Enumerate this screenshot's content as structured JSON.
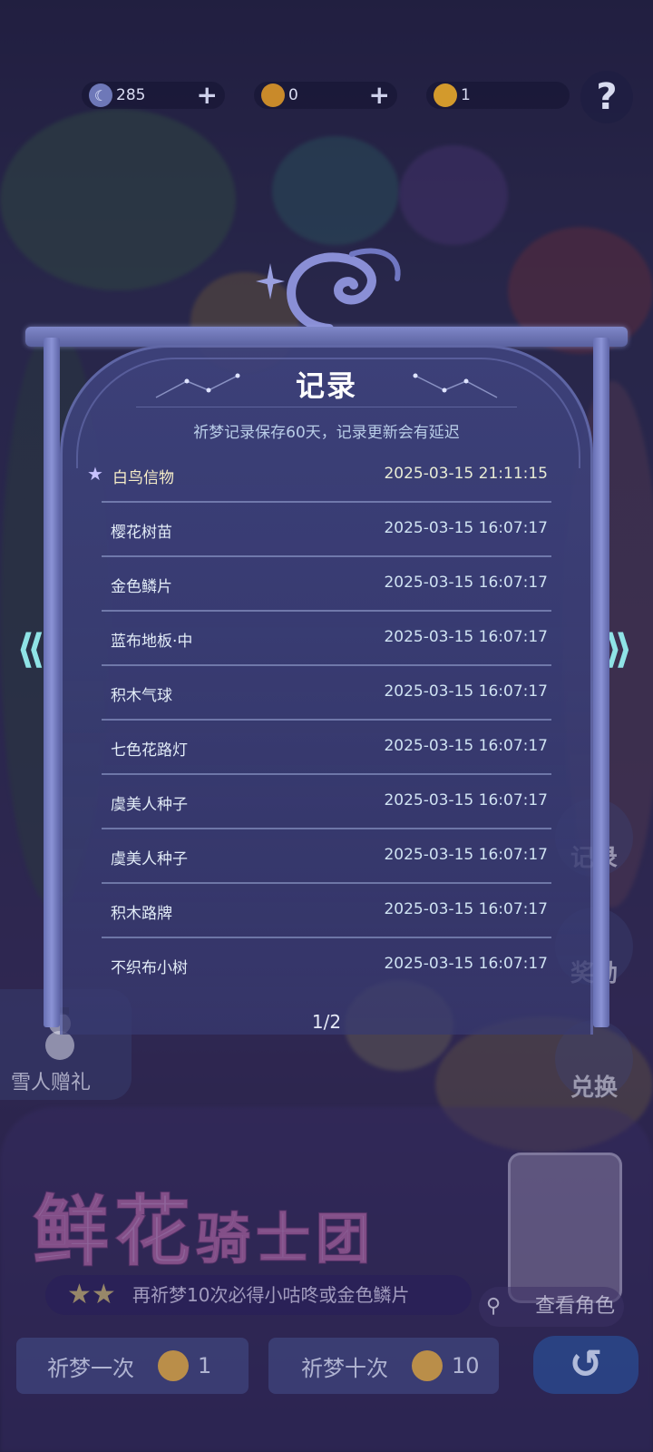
{
  "currency": [
    {
      "icon": "moon-icon",
      "value": "285",
      "plus": "+"
    },
    {
      "icon": "honey-coin-icon",
      "value": "0",
      "plus": "+"
    },
    {
      "icon": "gold-coin-icon",
      "value": "1"
    }
  ],
  "help": "?",
  "record": {
    "title": "记录",
    "subtitle": "祈梦记录保存60天，记录更新会有延迟",
    "entries": [
      {
        "name": "白鸟信物",
        "time": "2025-03-15 21:11:15"
      },
      {
        "name": "樱花树苗",
        "time": "2025-03-15 16:07:17"
      },
      {
        "name": "金色鳞片",
        "time": "2025-03-15 16:07:17"
      },
      {
        "name": "蓝布地板·中",
        "time": "2025-03-15 16:07:17"
      },
      {
        "name": "积木气球",
        "time": "2025-03-15 16:07:17"
      },
      {
        "name": "七色花路灯",
        "time": "2025-03-15 16:07:17"
      },
      {
        "name": "虞美人种子",
        "time": "2025-03-15 16:07:17"
      },
      {
        "name": "虞美人种子",
        "time": "2025-03-15 16:07:17"
      },
      {
        "name": "积木路牌",
        "time": "2025-03-15 16:07:17"
      },
      {
        "name": "不织布小树",
        "time": "2025-03-15 16:07:17"
      }
    ],
    "page": "1/2"
  },
  "side": {
    "left_arrow": "⟪",
    "right_arrow": "⟫",
    "buttons": [
      "记录",
      "奖励",
      "兑换"
    ]
  },
  "snowman_gift": "雪人赠礼",
  "banner": {
    "title_big": "鲜花",
    "title_small": "骑士团",
    "promo": "再祈梦10次必得小咕咚或金色鳞片",
    "view_character": "查看角色"
  },
  "pray_once": {
    "label": "祈梦一次",
    "cost": "1"
  },
  "pray_ten": {
    "label": "祈梦十次",
    "cost": "10"
  },
  "back": "↺"
}
